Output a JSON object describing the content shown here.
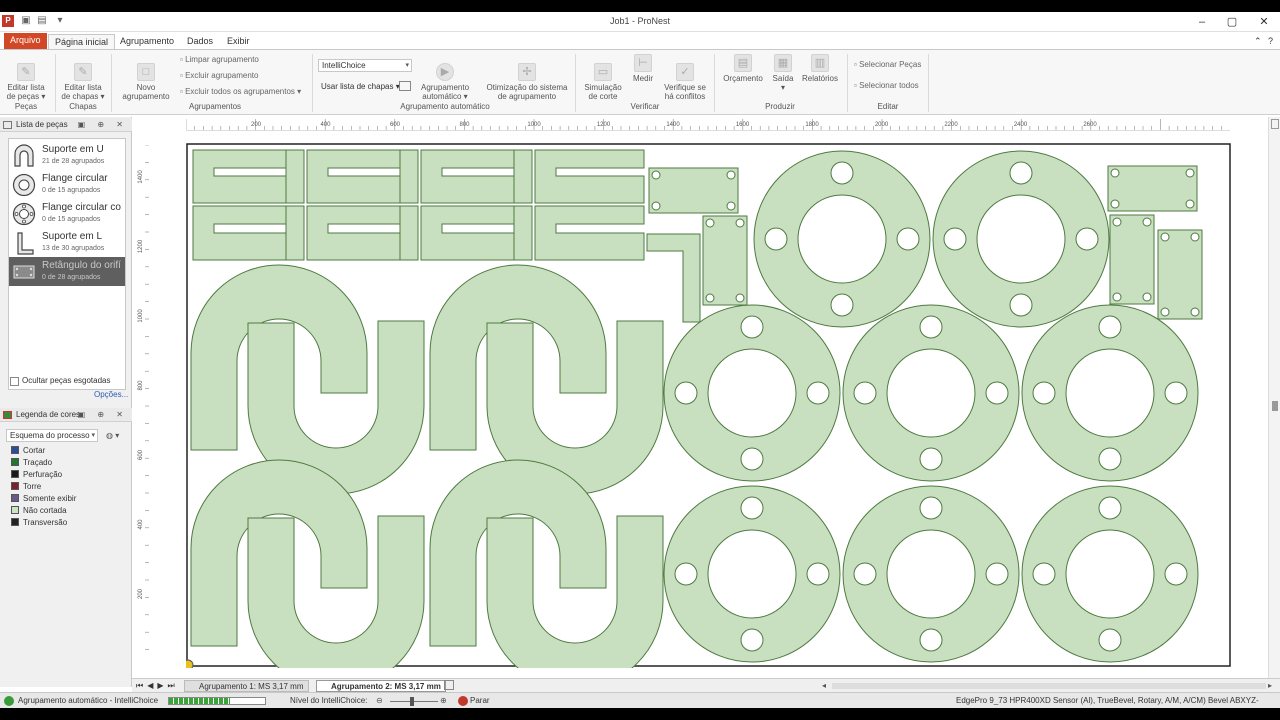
{
  "window": {
    "title": "Job1 - ProNest"
  },
  "ribbon_tabs": [
    "Arquivo",
    "Página inicial",
    "Agrupamento",
    "Dados",
    "Exibir"
  ],
  "ribbon": {
    "pecas": {
      "edit_parts": "Editar lista\nde peças",
      "label": "Peças"
    },
    "chapas": {
      "edit_plates": "Editar lista\nde chapas",
      "label": "Chapas"
    },
    "agrupamentos": {
      "new_nest": "Novo\nagrupamento",
      "clear_nest": "Limpar agrupamento",
      "delete_nest": "Excluir agrupamento",
      "delete_all": "Excluir todos os agrupamentos",
      "label": "Agrupamentos"
    },
    "auto": {
      "strategy": "IntelliChoice",
      "plate_list": "Usar lista de chapas",
      "auto_nest": "Agrupamento\nautomático",
      "optimize": "Otimização do sistema\nde agrupamento",
      "label": "Agrupamento automático"
    },
    "verificar": {
      "simulate": "Simulação\nde corte",
      "measure": "Medir",
      "check": "Verifique se\nhá conflitos",
      "label": "Verificar"
    },
    "produzir": {
      "quote": "Orçamento",
      "output": "Saída",
      "reports": "Relatórios",
      "label": "Produzir"
    },
    "editar": {
      "select_parts": "Selecionar Peças",
      "select_all": "Selecionar todos",
      "label": "Editar"
    }
  },
  "parts_panel": {
    "title": "Lista de peças",
    "items": [
      {
        "name": "Suporte em U",
        "sub": "21 de 28 agrupados"
      },
      {
        "name": "Flange circular",
        "sub": "0 de 15 agrupados"
      },
      {
        "name": "Flange circular co",
        "sub": "0 de 15 agrupados"
      },
      {
        "name": "Suporte em L",
        "sub": "13 de 30 agrupados"
      },
      {
        "name": "Retângulo do orifí",
        "sub": "0 de 28 agrupados"
      }
    ],
    "hide_label": "Ocultar peças esgotadas",
    "options": "Opções..."
  },
  "legend_panel": {
    "title": "Legenda de cores",
    "scheme": "Esquema do processo",
    "items": [
      {
        "label": "Cortar",
        "color": "#2a4e9c"
      },
      {
        "label": "Traçado",
        "color": "#1f7a2f"
      },
      {
        "label": "Perfuração",
        "color": "#1a1a1a"
      },
      {
        "label": "Torre",
        "color": "#7a2030"
      },
      {
        "label": "Somente exibir",
        "color": "#6a5a8c"
      },
      {
        "label": "Não cortada",
        "color": "#c8e6c0"
      },
      {
        "label": "Transversão",
        "color": "#222222"
      }
    ]
  },
  "ruler": {
    "top": [
      "200",
      "400",
      "600",
      "800",
      "1000",
      "1200",
      "1400",
      "1600",
      "1800",
      "2000",
      "2200",
      "2400",
      "2600"
    ],
    "left": [
      "1400",
      "1200",
      "1000",
      "800",
      "600",
      "400",
      "200"
    ]
  },
  "sheet_tabs": [
    "Agrupamento 1: MS 3,17 mm",
    "Agrupamento 2: MS 3,17 mm"
  ],
  "status": {
    "auto_nesting": "Agrupamento automático - IntelliChoice",
    "level_label": "Nível do IntelliChoice:",
    "stop": "Parar",
    "process": "EdgePro 9_73 HPR400XD Sensor (Al), TrueBevel, Rotary, A/M, A/CM) Bevel ABXYZ-"
  },
  "colors": {
    "part_fill": "#c8e0c0",
    "part_stroke": "#4e7a40",
    "file_tab": "#d24726"
  }
}
